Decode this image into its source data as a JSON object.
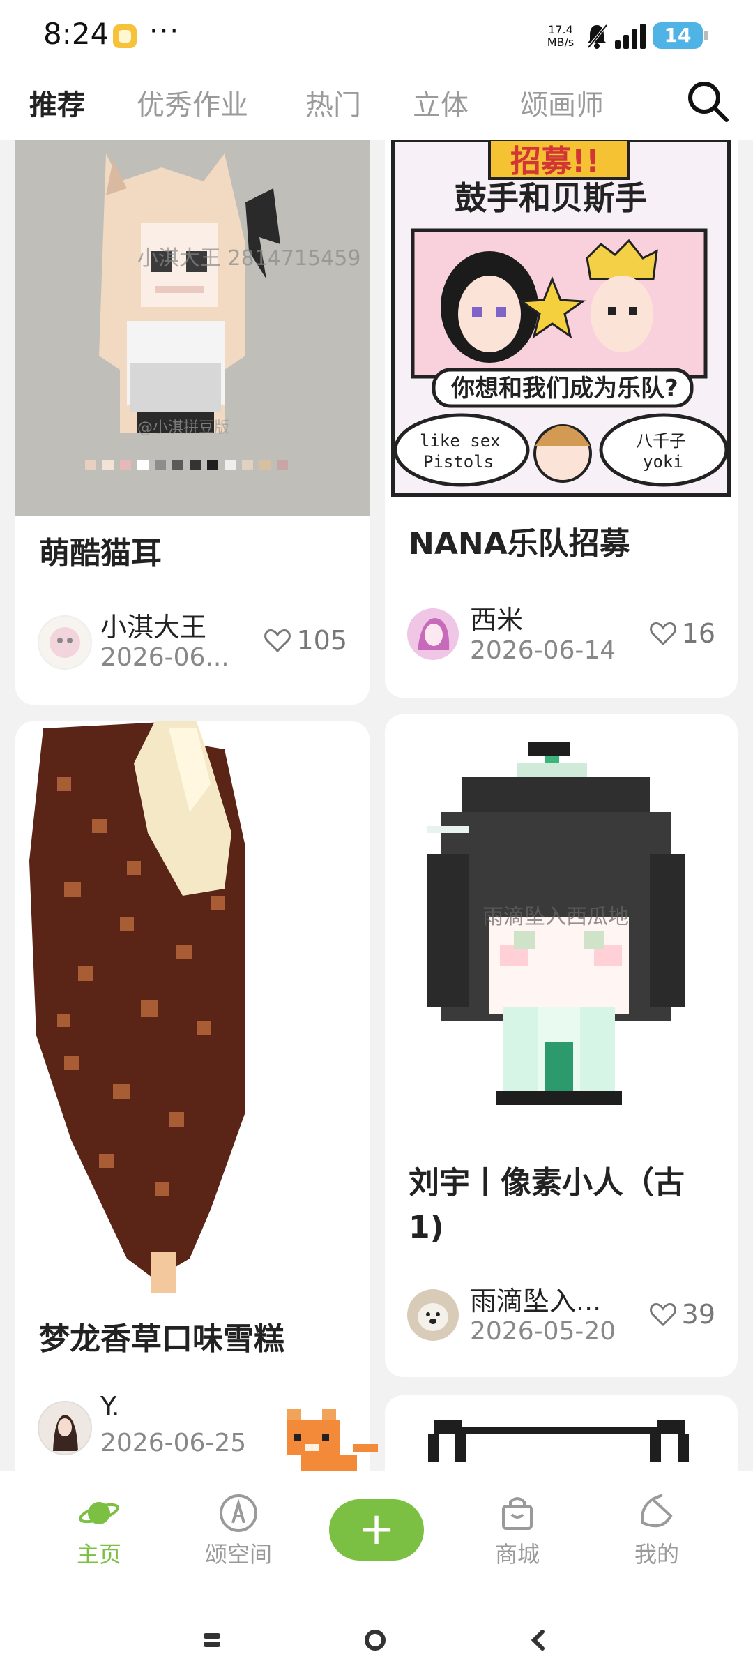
{
  "status_bar": {
    "time": "8:24",
    "more": "···",
    "net_speed_value": "17.4",
    "net_speed_unit": "MB/s",
    "battery": "14"
  },
  "tabs": [
    {
      "label": "推荐",
      "active": true
    },
    {
      "label": "优秀作业"
    },
    {
      "label": "热门"
    },
    {
      "label": "立体"
    },
    {
      "label": "颂画师"
    }
  ],
  "cards": [
    {
      "title": "萌酷猫耳",
      "author": "小淇大王",
      "date": "2026-06...",
      "likes": "105",
      "image_watermark": "小淇大王 2814715459",
      "image_credit": "@小淇拼豆版"
    },
    {
      "title": "NANA乐队招募",
      "author": "西米",
      "date": "2026-06-14",
      "likes": "16"
    },
    {
      "title": "梦龙香草口味雪糕",
      "author": "Y.",
      "date": "2026-06-25"
    },
    {
      "title": "刘宇丨像素小人（古1)",
      "author": "雨滴坠入...",
      "date": "2026-05-20",
      "likes": "39",
      "image_watermark": "雨滴坠入西瓜地"
    }
  ],
  "poster_text": {
    "headline": "招募!!",
    "sub": "鼓手和贝斯手",
    "question": "你想和我们成为乐队?",
    "bubble_left_1": "like sex",
    "bubble_left_2": "Pistols",
    "bubble_right_1": "八千子",
    "bubble_right_2": "yoki"
  },
  "bottom_nav": [
    {
      "label": "主页",
      "icon": "planet-icon",
      "active": true
    },
    {
      "label": "颂空间",
      "icon": "pen-circle-icon"
    },
    {
      "label": "+",
      "icon": "add-icon"
    },
    {
      "label": "商城",
      "icon": "shopping-bag-icon"
    },
    {
      "label": "我的",
      "icon": "profile-icon"
    }
  ],
  "colors": {
    "accent": "#7bc043",
    "background": "#f2f2f2",
    "card": "#ffffff"
  }
}
